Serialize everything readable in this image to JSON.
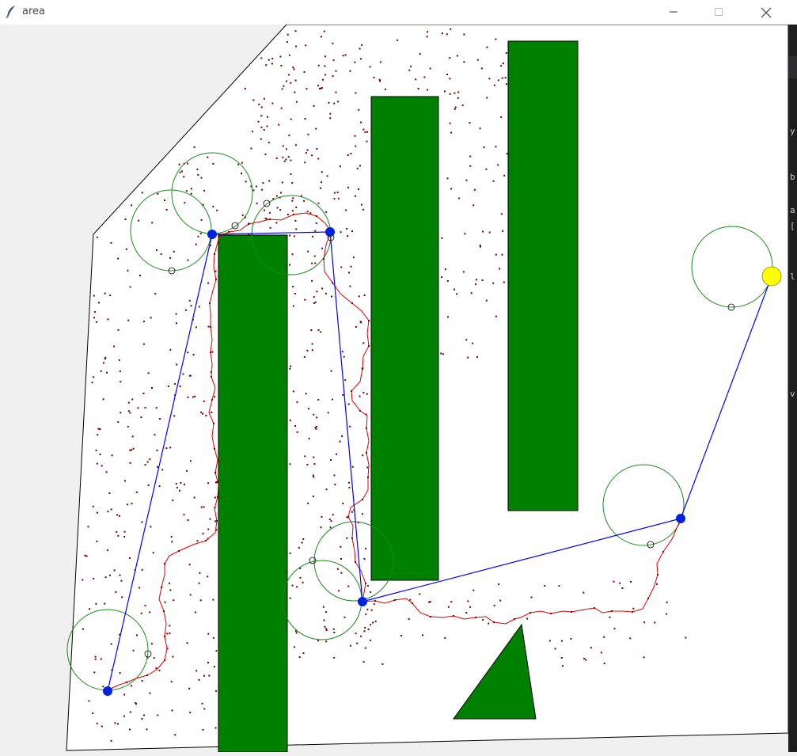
{
  "window": {
    "title": "area",
    "icon": "feather-icon",
    "controls": [
      "minimize-icon",
      "maximize-icon",
      "close-icon"
    ]
  },
  "colors": {
    "obstacle": "#008000",
    "obstacle_stroke": "#000000",
    "waypoint": "#0022dd",
    "goal": "#ffff00",
    "tree_path": "#e00000",
    "sample_point": "#6b0000",
    "route": "#0000ff",
    "radius_circle": "#1a8a1a",
    "boundary": "#000000"
  },
  "side_strip": {
    "glyphs": [
      "y",
      "b",
      "a",
      "[",
      "l",
      "v"
    ]
  }
}
